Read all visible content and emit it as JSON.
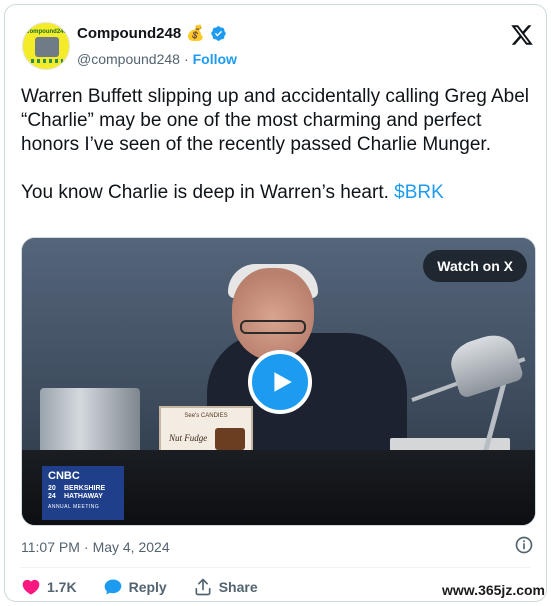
{
  "author": {
    "display_name": "Compound248",
    "name_emoji": "💰",
    "handle": "@compound248",
    "separator": "·",
    "follow_label": "Follow",
    "avatar_text": "Compound248"
  },
  "tweet": {
    "paragraph_1": "Warren Buffett slipping up and accidentally calling Greg Abel “Charlie” may be one of the most charming and perfect honors I’ve seen of the recently passed Charlie Munger.",
    "paragraph_2_text": "You know Charlie is deep in Warren’s heart. ",
    "cashtag": "$BRK"
  },
  "media": {
    "watch_label": "Watch on X",
    "fudge_brand": "See's CANDIES",
    "fudge_title": "Nut Fudge",
    "badge": {
      "network": "CNBC",
      "year_top": "20",
      "year_bottom": "24",
      "company_top": "BERKSHIRE",
      "company_bottom": "HATHAWAY",
      "event": "ANNUAL MEETING"
    }
  },
  "meta": {
    "time": "11:07 PM",
    "separator": "·",
    "date": "May 4, 2024"
  },
  "actions": {
    "likes": "1.7K",
    "reply_label": "Reply",
    "share_label": "Share"
  },
  "watermark": "www.365jz.com",
  "colors": {
    "accent": "#1d9bf0",
    "like": "#f91880",
    "text": "#0f1419",
    "muted": "#536471"
  }
}
